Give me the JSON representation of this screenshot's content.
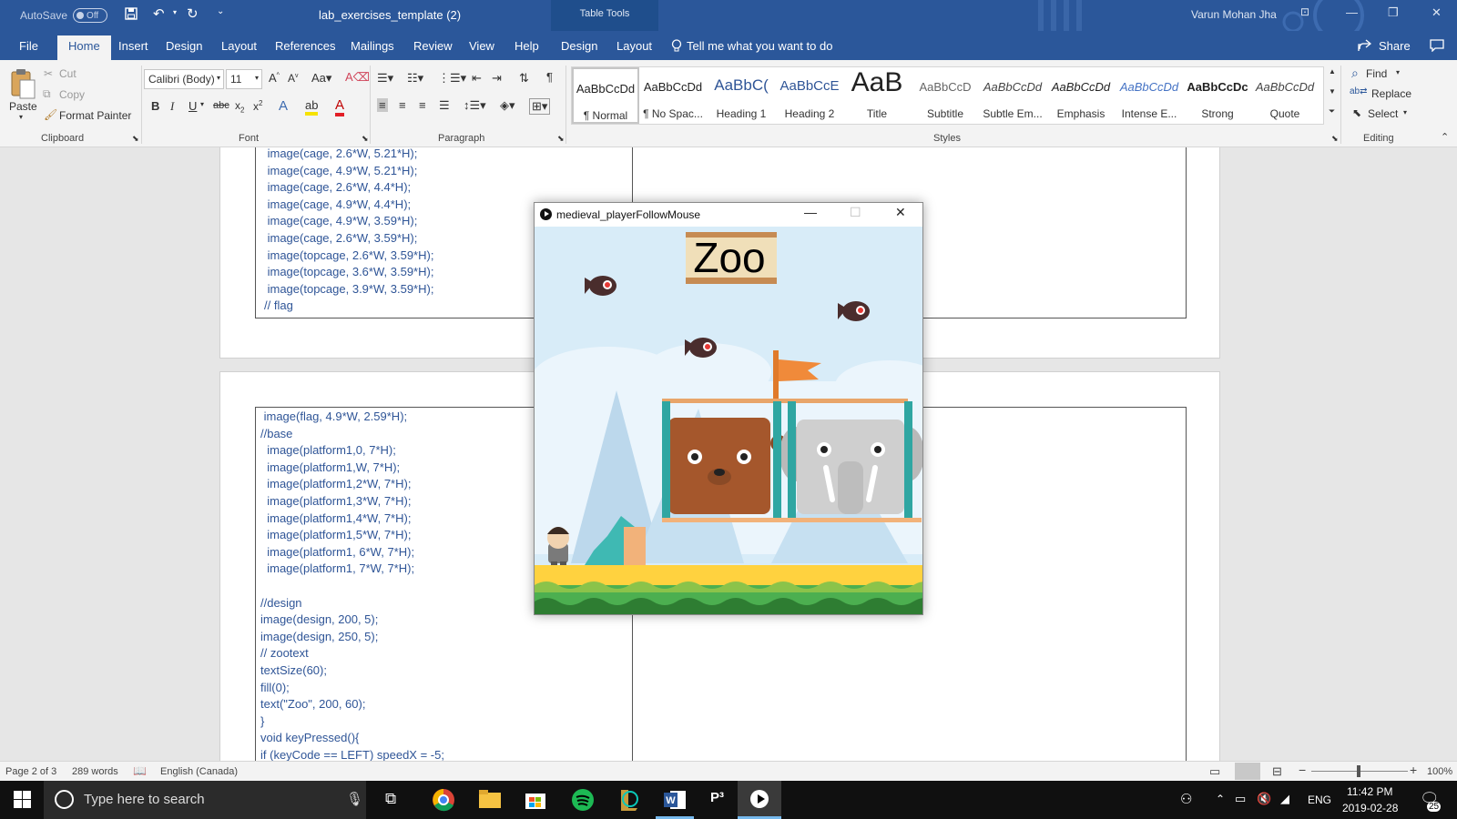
{
  "titlebar": {
    "autosave_label": "AutoSave",
    "autosave_state": "Off",
    "doc_title": "lab_exercises_template (2)",
    "context_tab_group": "Table Tools",
    "user_name": "Varun Mohan Jha"
  },
  "tabs": [
    "File",
    "Home",
    "Insert",
    "Design",
    "Layout",
    "References",
    "Mailings",
    "Review",
    "View",
    "Help",
    "Design",
    "Layout"
  ],
  "tell_me": "Tell me what you want to do",
  "share_label": "Share",
  "clipboard": {
    "paste": "Paste",
    "cut": "Cut",
    "copy": "Copy",
    "format_painter": "Format Painter",
    "group": "Clipboard"
  },
  "font": {
    "family": "Calibri (Body)",
    "size": "11",
    "group": "Font"
  },
  "paragraph": {
    "group": "Paragraph"
  },
  "styles": {
    "group": "Styles",
    "items": [
      {
        "preview": "AaBbCcDd",
        "name": "¶ Normal"
      },
      {
        "preview": "AaBbCcDd",
        "name": "¶ No Spac..."
      },
      {
        "preview": "AaBbC(",
        "name": "Heading 1"
      },
      {
        "preview": "AaBbCcE",
        "name": "Heading 2"
      },
      {
        "preview": "AaB",
        "name": "Title"
      },
      {
        "preview": "AaBbCcD",
        "name": "Subtitle"
      },
      {
        "preview": "AaBbCcDd",
        "name": "Subtle Em..."
      },
      {
        "preview": "AaBbCcDd",
        "name": "Emphasis"
      },
      {
        "preview": "AaBbCcDd",
        "name": "Intense E..."
      },
      {
        "preview": "AaBbCcDc",
        "name": "Strong"
      },
      {
        "preview": "AaBbCcDd",
        "name": "Quote"
      }
    ]
  },
  "editing": {
    "find": "Find",
    "replace": "Replace",
    "select": "Select",
    "group": "Editing"
  },
  "code_top": [
    " image(cage, 2.6*W, 5.21*H);",
    " image(cage, 4.9*W, 5.21*H);",
    " image(cage, 2.6*W, 4.4*H);",
    " image(cage, 4.9*W, 4.4*H);",
    " image(cage, 4.9*W, 3.59*H);",
    " image(cage, 2.6*W, 3.59*H);",
    " image(topcage, 2.6*W, 3.59*H);",
    " image(topcage, 3.6*W, 3.59*H);",
    " image(topcage, 3.9*W, 3.59*H);",
    "// flag"
  ],
  "code_bottom": [
    " image(flag, 4.9*W, 2.59*H);",
    "//base",
    "  image(platform1,0, 7*H);",
    "  image(platform1,W, 7*H);",
    "  image(platform1,2*W, 7*H);",
    "  image(platform1,3*W, 7*H);",
    "  image(platform1,4*W, 7*H);",
    "  image(platform1,5*W, 7*H);",
    "  image(platform1, 6*W, 7*H);",
    "  image(platform1, 7*W, 7*H);",
    "",
    "//design",
    "image(design, 200, 5);",
    "image(design, 250, 5);",
    "// zootext",
    "textSize(60);",
    "fill(0);",
    "text(\"Zoo\", 200, 60);",
    "}",
    "void keyPressed(){",
    "if (keyCode == LEFT) speedX = -5;"
  ],
  "app_window": {
    "title": "medieval_playerFollowMouse",
    "sign_text": "Zoo"
  },
  "statusbar": {
    "page": "Page 2 of 3",
    "words": "289 words",
    "language": "English (Canada)",
    "zoom": "100%"
  },
  "taskbar": {
    "search_placeholder": "Type here to search",
    "lang": "ENG",
    "time": "11:42 PM",
    "date": "2019-02-28",
    "notif_count": "25"
  }
}
